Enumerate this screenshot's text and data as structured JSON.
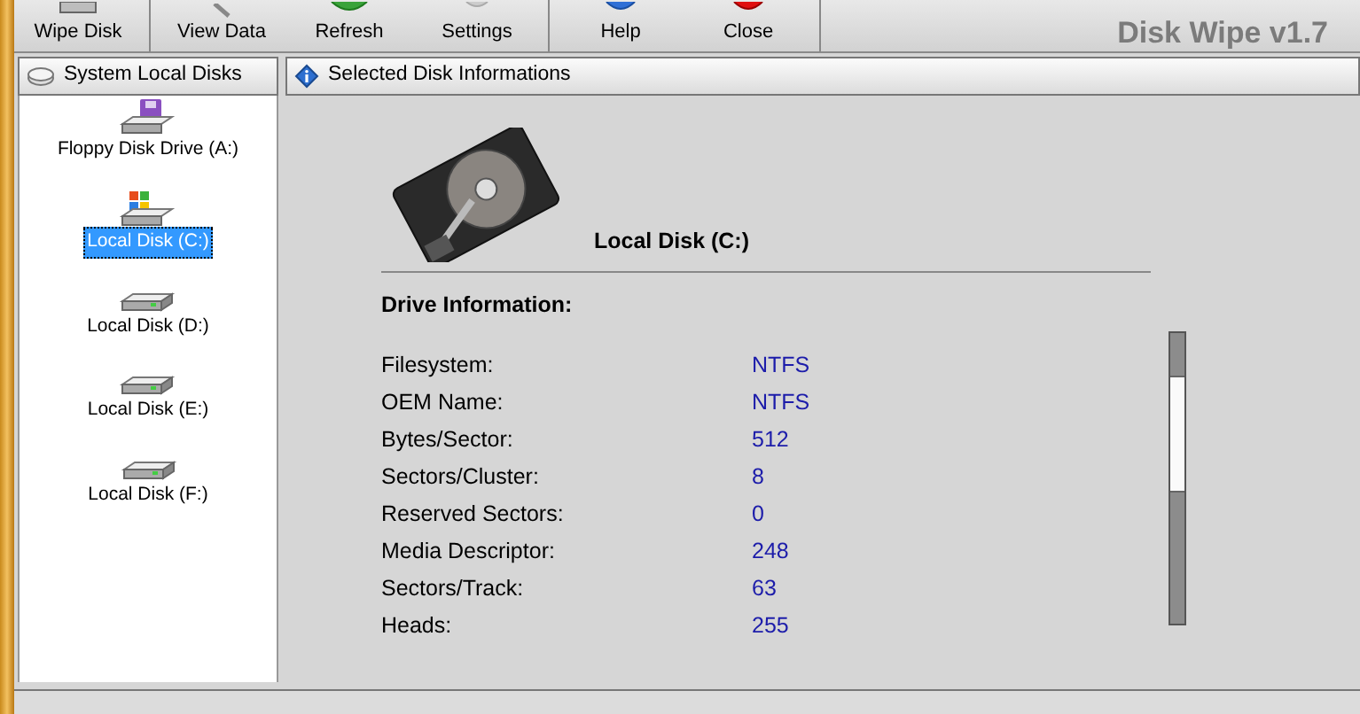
{
  "toolbar": {
    "buttons": [
      {
        "label": "Wipe Disk",
        "kind": "disk"
      },
      {
        "label": "View Data",
        "kind": "magnifier"
      },
      {
        "label": "Refresh",
        "kind": "refresh"
      },
      {
        "label": "Settings",
        "kind": "gear"
      },
      {
        "label": "Help",
        "kind": "help"
      },
      {
        "label": "Close",
        "kind": "close"
      }
    ],
    "title": "Disk Wipe v1.7"
  },
  "sidebar": {
    "header": "System Local Disks",
    "items": [
      {
        "label": "Floppy Disk Drive (A:)",
        "kind": "floppy",
        "selected": false
      },
      {
        "label": "Local Disk (C:)",
        "kind": "system",
        "selected": true
      },
      {
        "label": "Local Disk (D:)",
        "kind": "disk",
        "selected": false
      },
      {
        "label": "Local Disk (E:)",
        "kind": "disk",
        "selected": false
      },
      {
        "label": "Local Disk (F:)",
        "kind": "disk",
        "selected": false
      }
    ]
  },
  "details": {
    "header": "Selected Disk Informations",
    "disk_name": "Local Disk  (C:)",
    "section_title": "Drive Information:",
    "rows": [
      {
        "label": "Filesystem:",
        "value": "NTFS"
      },
      {
        "label": "OEM Name:",
        "value": "NTFS"
      },
      {
        "label": "Bytes/Sector:",
        "value": "512"
      },
      {
        "label": "Sectors/Cluster:",
        "value": "8"
      },
      {
        "label": "Reserved Sectors:",
        "value": "0"
      },
      {
        "label": "Media Descriptor:",
        "value": "248"
      },
      {
        "label": "Sectors/Track:",
        "value": "63"
      },
      {
        "label": "Heads:",
        "value": "255"
      }
    ]
  }
}
